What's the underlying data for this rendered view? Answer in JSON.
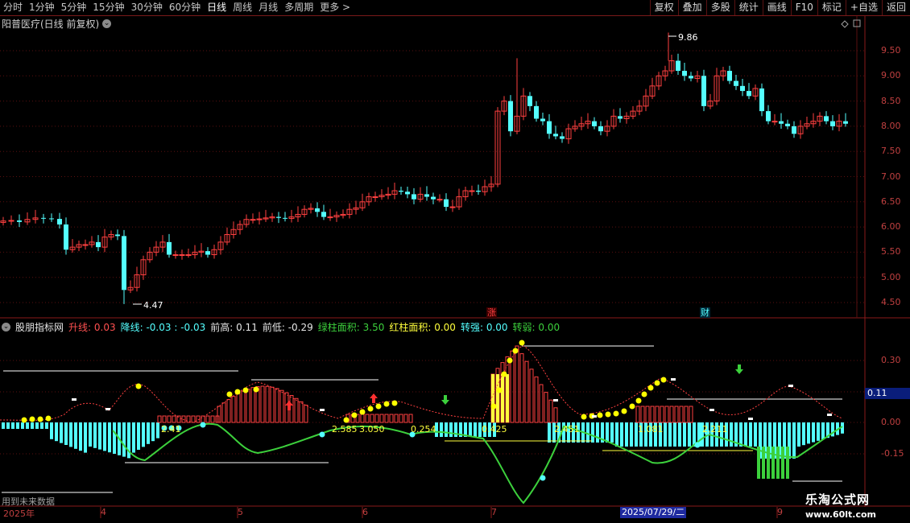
{
  "toolbar": {
    "periods": [
      "分时",
      "1分钟",
      "5分钟",
      "15分钟",
      "30分钟",
      "60分钟",
      "日线",
      "周线",
      "月线",
      "多周期",
      "更多 >"
    ],
    "active_period": "日线",
    "buttons": [
      "复权",
      "叠加",
      "多股",
      "统计",
      "画线",
      "F10",
      "标记",
      "+自选",
      "返回"
    ]
  },
  "main_chart": {
    "title": "阳普医疗(日线 前复权)",
    "y_ticks": [
      "9.50",
      "9.00",
      "8.50",
      "8.00",
      "7.50",
      "7.00",
      "6.50",
      "6.00",
      "5.50",
      "5.00",
      "4.50"
    ],
    "high_label": "9.86",
    "low_label": "4.47",
    "markers": {
      "limit_up": "涨",
      "finance": "财"
    }
  },
  "indicator": {
    "name": "股朋指标网",
    "items": [
      {
        "label": "升线:",
        "value": "0.03",
        "color": "red"
      },
      {
        "label": "降线:",
        "value": "-0.03 : -0.03",
        "color": "cyan"
      },
      {
        "label": "前高:",
        "value": "0.11",
        "color": "white"
      },
      {
        "label": "前低:",
        "value": "-0.29",
        "color": "white"
      },
      {
        "label": "绿柱面积:",
        "value": "3.50",
        "color": "green"
      },
      {
        "label": "红柱面积:",
        "value": "0.00",
        "color": "yellow"
      },
      {
        "label": "转强:",
        "value": "0.00",
        "color": "cyan"
      },
      {
        "label": "转弱:",
        "value": "0.00",
        "color": "green"
      }
    ],
    "y_ticks": [
      "0.30",
      "0.15",
      "0.00",
      "-0.15"
    ],
    "current_value": "0.11",
    "value_labels": [
      "2.585",
      "3.050",
      "0.254",
      "0.425",
      "2.451",
      "1.081",
      "2.211"
    ],
    "dots_left_label": "2.41"
  },
  "dates": {
    "year": "2025年",
    "months": [
      "4",
      "5",
      "6",
      "7",
      "9"
    ],
    "selected": "2025/07/29/二"
  },
  "footnote": "用到未来数据",
  "watermark": {
    "name": "乐淘公式网",
    "url": "www.60lt.com"
  }
}
